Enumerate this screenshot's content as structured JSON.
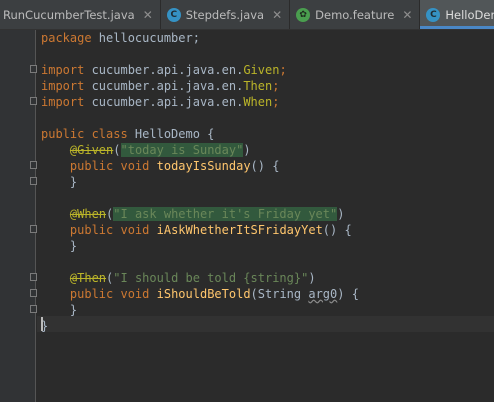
{
  "tabs": [
    {
      "label": "RunCucumberTest.java",
      "icon": "java-class-icon",
      "active": false
    },
    {
      "label": "Stepdefs.java",
      "icon": "java-class-icon",
      "active": false
    },
    {
      "label": "Demo.feature",
      "icon": "cucumber-icon",
      "active": false
    },
    {
      "label": "HelloDemo.java",
      "icon": "java-class-icon",
      "active": true
    }
  ],
  "code": {
    "package_kw": "package",
    "package_name": " hellocucumber;",
    "import_kw": "import",
    "imports": [
      {
        "prefix": " cucumber.api.java.en.",
        "name": "Given",
        "end": ";"
      },
      {
        "prefix": " cucumber.api.java.en.",
        "name": "Then",
        "end": ";"
      },
      {
        "prefix": " cucumber.api.java.en.",
        "name": "When",
        "end": ";"
      }
    ],
    "class_kw": "public class",
    "class_name": " HelloDemo {",
    "methods": [
      {
        "annotation": "@Given",
        "step_text": "\"today is Sunday\"",
        "sig_kw": "public void",
        "method_name": "todayIsSunday",
        "params_text": "() {",
        "close": "}"
      },
      {
        "annotation": "@When",
        "step_text": "\"I ask whether it's Friday yet\"",
        "sig_kw": "public void",
        "method_name": "iAskWhetherItSFridayYet",
        "params_text": "() {",
        "close": "}"
      },
      {
        "annotation": "@Then",
        "step_text": "\"I should be told {string}\"",
        "sig_kw": "public void",
        "method_name": "iShouldBeTold",
        "param_type": "(String ",
        "param_name": "arg0",
        "params_end": ") {",
        "close": "}"
      }
    ],
    "class_close": "}"
  },
  "colors": {
    "background": "#2b2b2b",
    "keyword": "#cc7832",
    "string": "#6a8759",
    "annotation": "#bbb529",
    "method": "#ffc66d",
    "text": "#a9b7c6",
    "active_tab_underline": "#4a88c7"
  }
}
